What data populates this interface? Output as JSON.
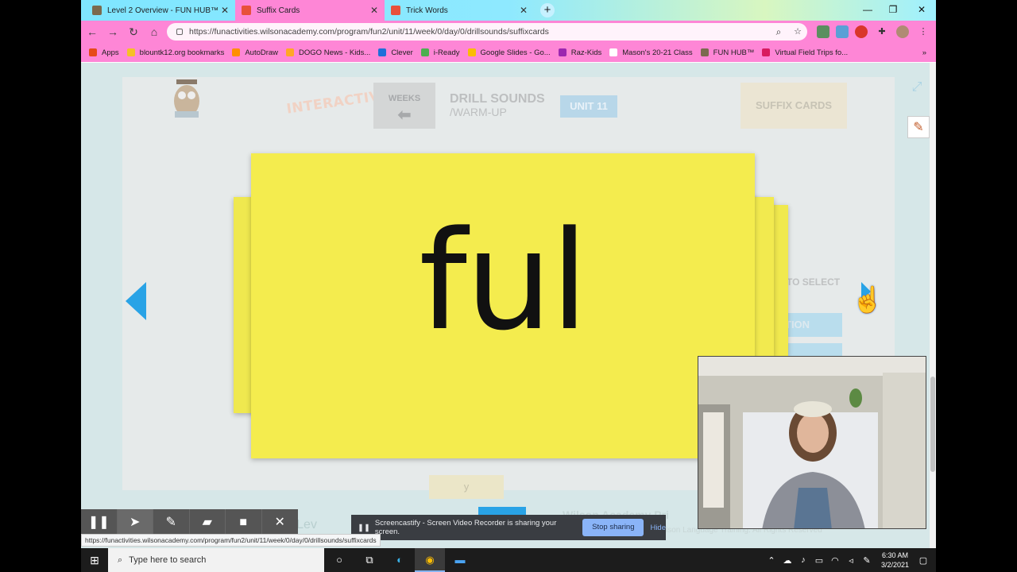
{
  "tabs": [
    {
      "label": "Level 2 Overview - FUN HUB™",
      "favicon_color": "#7b6a4e",
      "close": "✕"
    },
    {
      "label": "Suffix Cards",
      "favicon_color": "#e8513b",
      "close": "✕"
    },
    {
      "label": "Trick Words",
      "favicon_color": "#e8513b",
      "close": "✕"
    }
  ],
  "new_tab": "+",
  "window_controls": {
    "minimize": "—",
    "restore": "❐",
    "close": "✕"
  },
  "nav": {
    "back": "←",
    "forward": "→",
    "reload": "↻",
    "home": "⌂"
  },
  "url": "https://funactivities.wilsonacademy.com/program/fun2/unit/11/week/0/day/0/drillsounds/suffixcards",
  "bookmarks": [
    {
      "label": "Apps",
      "color": "#e64a19"
    },
    {
      "label": "blountk12.org bookmarks",
      "color": "#f6c026"
    },
    {
      "label": "AutoDraw",
      "color": "#ff8f00"
    },
    {
      "label": "DOGO News - Kids...",
      "color": "#ffa726"
    },
    {
      "label": "Clever",
      "color": "#1e6fd9"
    },
    {
      "label": "i-Ready",
      "color": "#4caf50"
    },
    {
      "label": "Google Slides - Go...",
      "color": "#fbbc04"
    },
    {
      "label": "Raz-Kids",
      "color": "#9c27b0"
    },
    {
      "label": "Mason's 20-21 Class",
      "color": "#ffffff"
    },
    {
      "label": "FUN HUB™",
      "color": "#7b6a4e"
    },
    {
      "label": "Virtual Field Trips fo...",
      "color": "#d81b60"
    }
  ],
  "bookmarks_more": "»",
  "app": {
    "logo_text": "INTERACTIVITIES",
    "weeks_label": "WEEKS",
    "drill_title": "DRILL SOUNDS",
    "drill_subtitle": "/WARM-UP",
    "unit_badge": "UNIT 11",
    "suffix_button": "SUFFIX CARDS",
    "tap_select": "TO SELECT",
    "action1": "TION",
    "card_word": "ful",
    "footer_card": "y",
    "footer_text": "Wilson Academy     Pri",
    "copyright": "lson Language Training. All Rights Reserved",
    "language": "nge Lev"
  },
  "sharing": {
    "text": "Screencastify - Screen Video Recorder is sharing your screen.",
    "stop": "Stop sharing",
    "hide": "Hide"
  },
  "status_url": "https://funactivities.wilsonacademy.com/program/fun2/unit/11/week/0/day/0/drillsounds/suffixcards",
  "taskbar": {
    "search_placeholder": "Type here to search",
    "time": "6:30 AM",
    "date": "3/2/2021"
  },
  "colors": {
    "accent_pink": "#fe86d6",
    "card_yellow": "#f4ec4e",
    "arrow_blue": "#29a3e6"
  }
}
